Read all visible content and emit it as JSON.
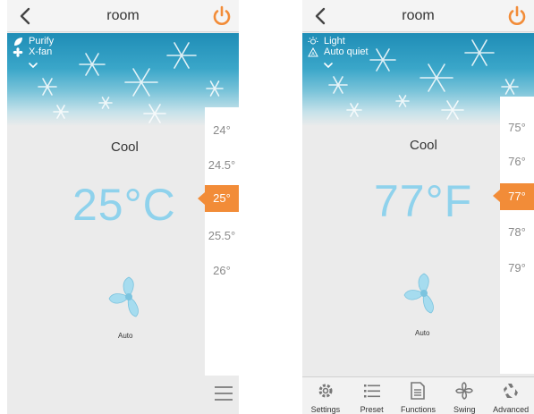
{
  "screens": {
    "left": {
      "title": "room",
      "modes": [
        {
          "label": "Purify",
          "icon": "leaf-icon"
        },
        {
          "label": "X-fan",
          "icon": "fan-small-icon"
        }
      ],
      "mode": "Cool",
      "temperature": "25°C",
      "temp_options": [
        "24°",
        "24.5°",
        "25°",
        "25.5°",
        "26°"
      ],
      "selected_temp": "25°",
      "fan_speed": "Auto"
    },
    "right": {
      "title": "room",
      "modes": [
        {
          "label": "Light",
          "icon": "light-icon"
        },
        {
          "label": "Auto quiet",
          "icon": "quiet-icon"
        }
      ],
      "mode": "Cool",
      "temperature": "77°F",
      "temp_options": [
        "75°",
        "76°",
        "77°",
        "78°",
        "79°"
      ],
      "selected_temp": "77°",
      "fan_speed": "Auto",
      "bottom_bar": [
        {
          "label": "Settings",
          "icon": "gear-icon"
        },
        {
          "label": "Preset",
          "icon": "list-icon"
        },
        {
          "label": "Functions",
          "icon": "document-icon"
        },
        {
          "label": "Swing",
          "icon": "swing-icon"
        },
        {
          "label": "Advanced",
          "icon": "recycle-icon"
        }
      ]
    }
  },
  "colors": {
    "accent": "#f28c38",
    "temp_text": "#8fd2ec",
    "fan": "#a6dcef",
    "banner_top": "#1f8db6"
  }
}
